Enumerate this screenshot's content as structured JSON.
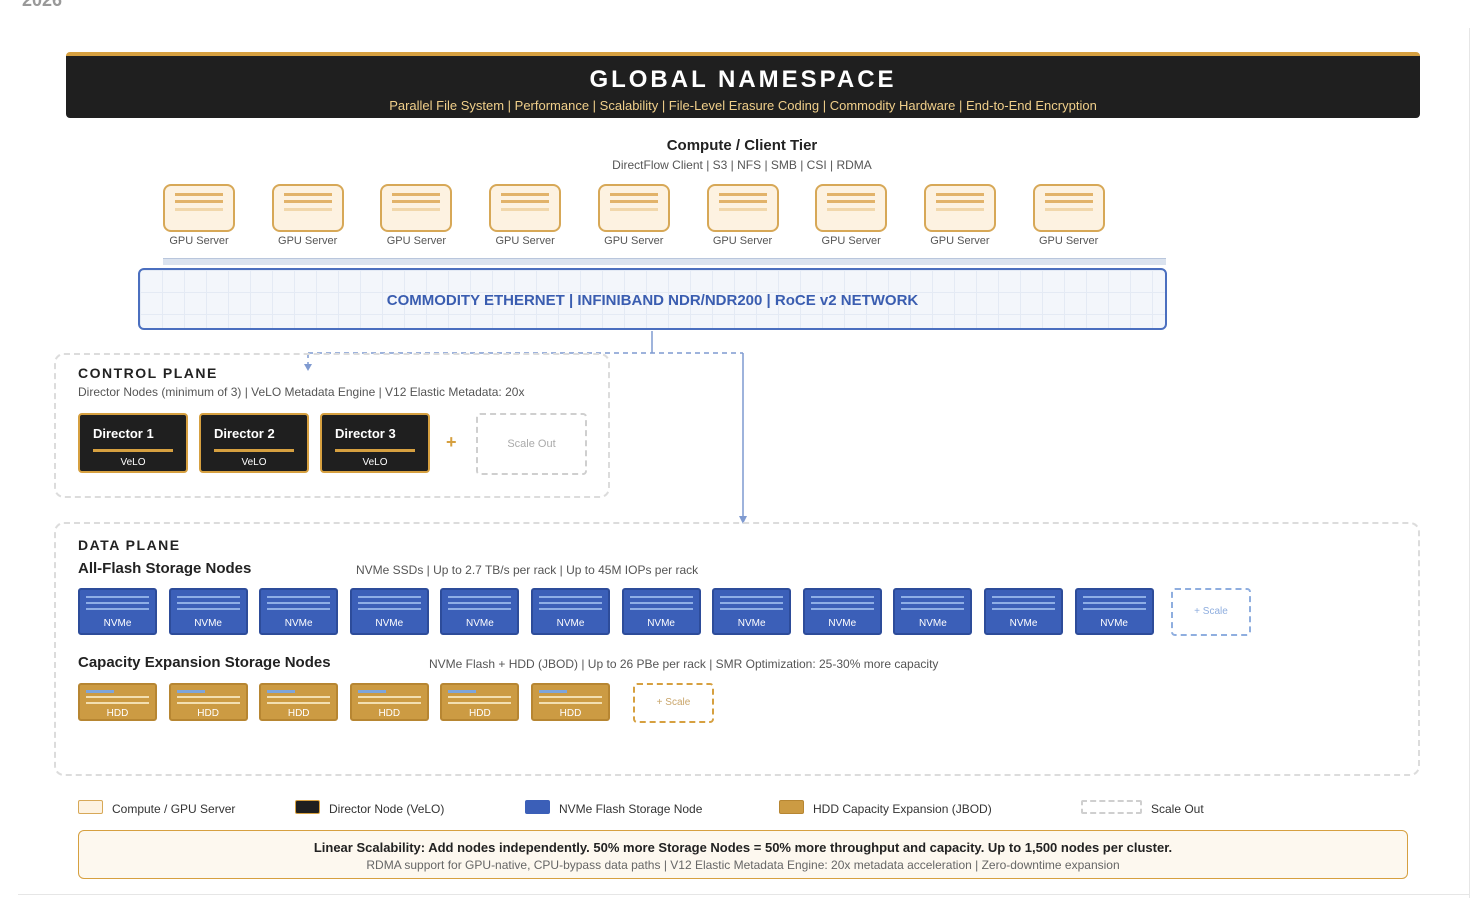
{
  "year": "2026",
  "namespace": {
    "title": "GLOBAL NAMESPACE",
    "subtitle": "Parallel File System | Performance | Scalability | File-Level Erasure Coding | Commodity Hardware | End-to-End Encryption"
  },
  "compute_tier": {
    "title": "Compute / Client Tier",
    "subtitle": "DirectFlow Client | S3 | NFS | SMB | CSI | RDMA",
    "servers": [
      "GPU Server",
      "GPU Server",
      "GPU Server",
      "GPU Server",
      "GPU Server",
      "GPU Server",
      "GPU Server",
      "GPU Server",
      "GPU Server"
    ]
  },
  "network": {
    "label": "COMMODITY ETHERNET | INFINIBAND NDR/NDR200 | RoCE v2 NETWORK"
  },
  "control_plane": {
    "title": "CONTROL PLANE",
    "subtitle": "Director Nodes (minimum of 3) | VeLO Metadata Engine | V12 Elastic Metadata: 20x",
    "directors": [
      {
        "name": "Director 1",
        "engine": "VeLO"
      },
      {
        "name": "Director 2",
        "engine": "VeLO"
      },
      {
        "name": "Director 3",
        "engine": "VeLO"
      }
    ],
    "plus": "+",
    "scale_out": "Scale Out"
  },
  "data_plane": {
    "title": "DATA PLANE",
    "all_flash": {
      "title": "All-Flash Storage Nodes",
      "subtitle": "NVMe SSDs | Up to 2.7 TB/s per rack | Up to 45M IOPs per rack",
      "nodes": [
        "NVMe",
        "NVMe",
        "NVMe",
        "NVMe",
        "NVMe",
        "NVMe",
        "NVMe",
        "NVMe",
        "NVMe",
        "NVMe",
        "NVMe",
        "NVMe"
      ],
      "scale": "+ Scale"
    },
    "capacity": {
      "title": "Capacity Expansion Storage Nodes",
      "subtitle": "NVMe Flash + HDD (JBOD) | Up to 26 PBe per rack | SMR Optimization: 25-30% more capacity",
      "nodes": [
        "HDD",
        "HDD",
        "HDD",
        "HDD",
        "HDD",
        "HDD"
      ],
      "scale": "+ Scale"
    }
  },
  "legend": [
    {
      "label": "Compute / GPU Server",
      "color": "#fdf2e1"
    },
    {
      "label": "Director Node (VeLO)",
      "color": "#1f1f1f"
    },
    {
      "label": "NVMe Flash Storage Node",
      "color": "#3b5fb8"
    },
    {
      "label": "HDD Capacity Expansion (JBOD)",
      "color": "#cc9b43"
    },
    {
      "label": "Scale Out",
      "color": "#ffffff"
    }
  ],
  "footer": {
    "main": "Linear Scalability: Add nodes independently. 50% more Storage Nodes = 50% more throughput and capacity. Up to 1,500 nodes per cluster.",
    "sub": "RDMA support for GPU-native, CPU-bypass data paths | V12 Elastic Metadata Engine: 20x metadata acceleration | Zero-downtime expansion"
  }
}
